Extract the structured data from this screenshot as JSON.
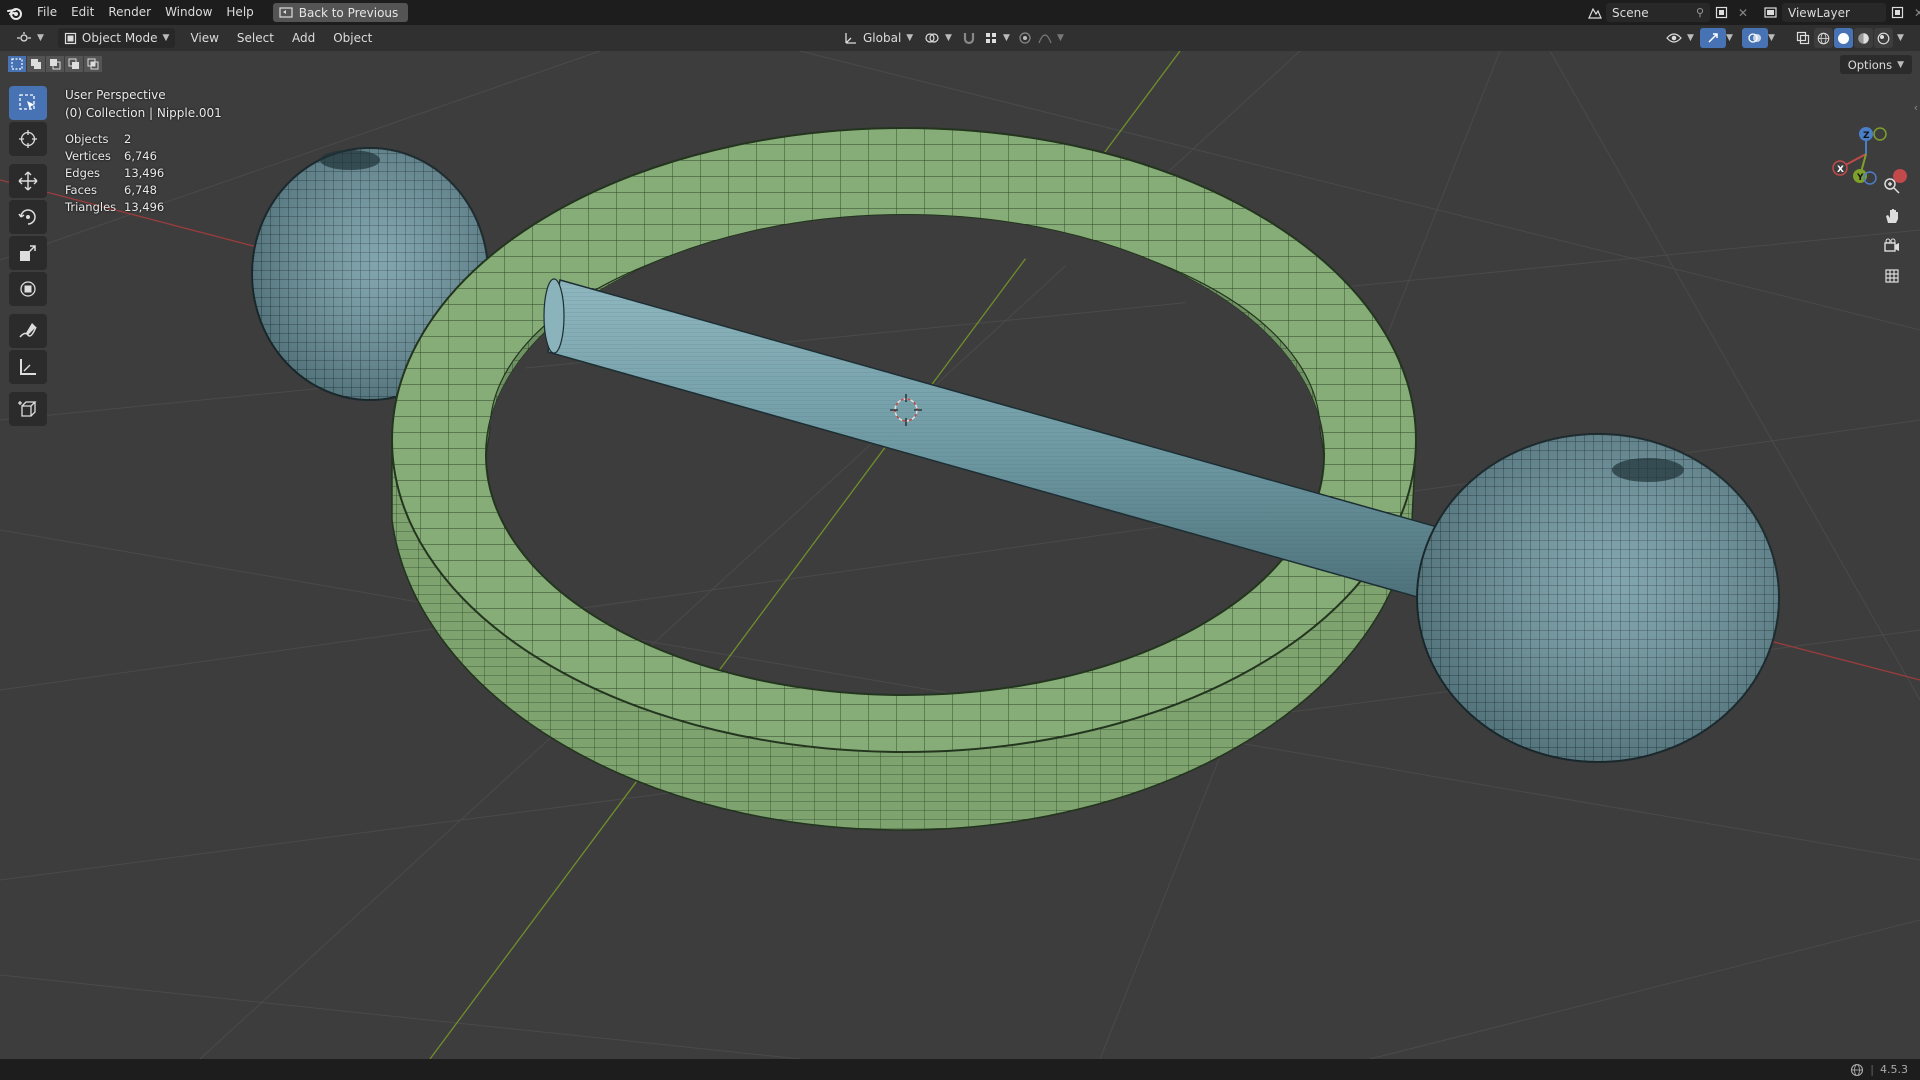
{
  "topbar": {
    "menus": [
      "File",
      "Edit",
      "Render",
      "Window",
      "Help"
    ],
    "back_button": "Back to Previous",
    "scene_name": "Scene",
    "view_layer": "ViewLayer"
  },
  "header": {
    "mode": "Object Mode",
    "menus": [
      "View",
      "Select",
      "Add",
      "Object"
    ],
    "transform_orientation": "Global"
  },
  "viewport": {
    "title": "User Perspective",
    "collection_line": "(0) Collection | Nipple.001",
    "stats": [
      {
        "label": "Objects",
        "value": "2"
      },
      {
        "label": "Vertices",
        "value": "6,746"
      },
      {
        "label": "Edges",
        "value": "13,496"
      },
      {
        "label": "Faces",
        "value": "6,748"
      },
      {
        "label": "Triangles",
        "value": "13,496"
      }
    ],
    "options_label": "Options",
    "gizmo": {
      "x": "X",
      "y": "Y",
      "z": "Z"
    }
  },
  "statusbar": {
    "version": "4.5.3"
  },
  "colors": {
    "ring": "#7fa870",
    "bar": "#6f9aa3",
    "x_axis": "#c24a4a",
    "y_axis": "#7fa02a",
    "accent": "#4772b3"
  },
  "icons": {
    "tools": [
      "select-box-icon",
      "cursor-icon",
      "move-icon",
      "rotate-icon",
      "scale-icon",
      "transform-icon",
      "annotate-icon",
      "measure-icon",
      "add-cube-icon"
    ]
  }
}
